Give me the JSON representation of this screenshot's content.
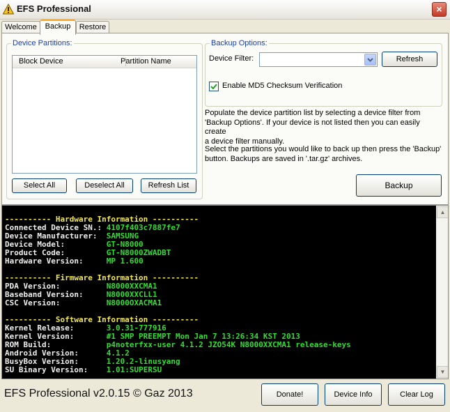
{
  "window": {
    "title": "EFS Professional",
    "close_label": "×"
  },
  "tabs": [
    {
      "label": "Welcome"
    },
    {
      "label": "Backup"
    },
    {
      "label": "Restore"
    }
  ],
  "device_partitions": {
    "group_label": "Device Partitions:",
    "columns": [
      "Block Device",
      "Partition Name"
    ],
    "buttons": {
      "select_all": "Select All",
      "deselect_all": "Deselect All",
      "refresh_list": "Refresh List"
    }
  },
  "backup_options": {
    "group_label": "Backup Options:",
    "device_filter_label": "Device Filter:",
    "device_filter_value": "",
    "refresh_label": "Refresh",
    "md5_label": "Enable MD5 Checksum Verification",
    "md5_checked": true
  },
  "info": {
    "para1_lines": [
      "Populate the device partition list by selecting a device filter from",
      "'Backup Options'. If your device is not listed then you can easily create",
      "a device filter manually."
    ],
    "para2_lines": [
      "Select the partitions you would like to back up then press the 'Backup'",
      "button. Backups are saved in '.tar.gz' archives."
    ]
  },
  "backup_button": "Backup",
  "console": {
    "sections": [
      {
        "header": "---------- Hardware Information ----------",
        "rows": [
          [
            "Connected Device SN.:",
            "4107f403c7887fe7"
          ],
          [
            "Device Manufacturer:",
            "SAMSUNG"
          ],
          [
            "Device Model:",
            "GT-N8000"
          ],
          [
            "Product Code:",
            "GT-N8000ZWADBT"
          ],
          [
            "Hardware Version:",
            "MP 1.600"
          ]
        ]
      },
      {
        "header": "---------- Firmware Information ----------",
        "rows": [
          [
            "PDA Version:",
            "N8000XXCMA1"
          ],
          [
            "Baseband Version:",
            "N8000XXCLL1"
          ],
          [
            "CSC Version:",
            "N8000OXACMA1"
          ]
        ]
      },
      {
        "header": "---------- Software Information ----------",
        "rows": [
          [
            "Kernel Release:",
            "3.0.31-777916"
          ],
          [
            "Kernel Version:",
            "#1 SMP PREEMPT Mon Jan 7 13:26:34 KST 2013"
          ],
          [
            "ROM Build:",
            "p4noterfxx-user 4.1.2 JZO54K N8000XXCMA1 release-keys"
          ],
          [
            "Android Version:",
            "4.1.2"
          ],
          [
            "BusyBox Version:",
            "1.20.2-linusyang"
          ],
          [
            "SU Binary Version:",
            "1.01:SUPERSU"
          ]
        ]
      }
    ]
  },
  "footer": {
    "title": "EFS Professional v2.0.15 © Gaz 2013",
    "donate": "Donate!",
    "device_info": "Device Info",
    "clear_log": "Clear Log"
  }
}
